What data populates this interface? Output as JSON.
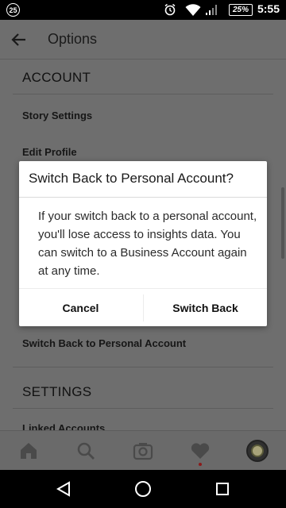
{
  "status_bar": {
    "notification_badge": "25",
    "battery": "25%",
    "time": "5:55",
    "icons": [
      "notification-badge-icon",
      "alarm-icon",
      "wifi-icon",
      "signal-icon",
      "battery-icon"
    ]
  },
  "header": {
    "title": "Options",
    "back_icon": "arrow-left-icon"
  },
  "sections": {
    "account_title": "ACCOUNT",
    "story_settings": "Story Settings",
    "edit_profile": "Edit Profile",
    "switch_back_item": "Switch Back to Personal Account",
    "settings_title": "SETTINGS",
    "linked_accounts": "Linked Accounts"
  },
  "dialog": {
    "title": "Switch Back to Personal Account?",
    "body": "If your switch back to a personal account, you'll lose access to insights data. You can switch to a Business Account again at any time.",
    "cancel_label": "Cancel",
    "confirm_label": "Switch Back"
  },
  "tab_bar": {
    "tabs": [
      "home-icon",
      "search-icon",
      "camera-icon",
      "heart-icon",
      "profile-avatar"
    ],
    "activity_dot_color": "#8b1a1a"
  },
  "nav_bar": {
    "buttons": [
      "back-triangle-icon",
      "home-circle-icon",
      "recents-square-icon"
    ]
  },
  "colors": {
    "dim_background": "#6e6e6e",
    "dialog_background": "#ffffff"
  }
}
